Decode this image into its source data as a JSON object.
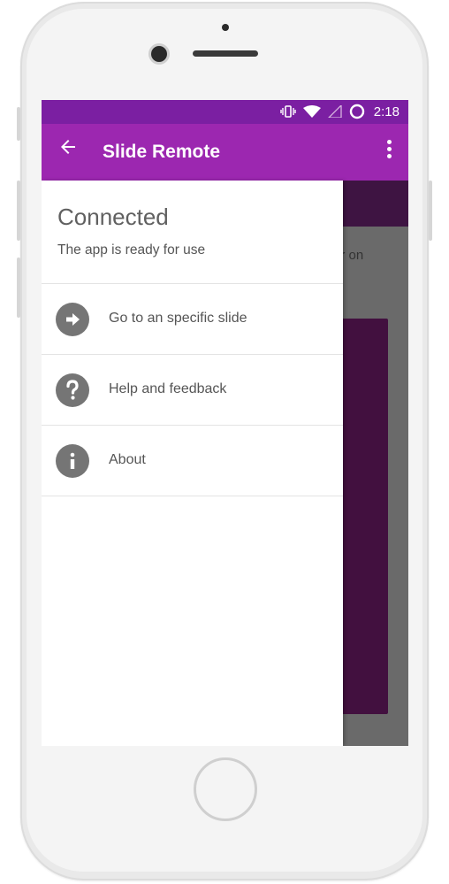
{
  "status_bar": {
    "time": "2:18",
    "icons": [
      "vibrate-icon",
      "wifi-icon",
      "signal-icon",
      "circle-icon"
    ]
  },
  "app_bar": {
    "title": "Slide Remote",
    "back_icon": "arrow-back-icon",
    "menu_icon": "more-vert-icon"
  },
  "drawer": {
    "title": "Connected",
    "subtitle": "The app is ready for use",
    "items": [
      {
        "label": "Go to an specific slide",
        "icon": "arrow-forward-circle-icon"
      },
      {
        "label": "Help and feedback",
        "icon": "help-circle-icon"
      },
      {
        "label": "About",
        "icon": "info-circle-icon"
      }
    ]
  },
  "background": {
    "partial_text": "er on"
  },
  "colors": {
    "status_bar": "#7b1fa2",
    "app_bar": "#9c27b0",
    "drawer_icon": "#757575",
    "background_panel": "#42103f"
  }
}
